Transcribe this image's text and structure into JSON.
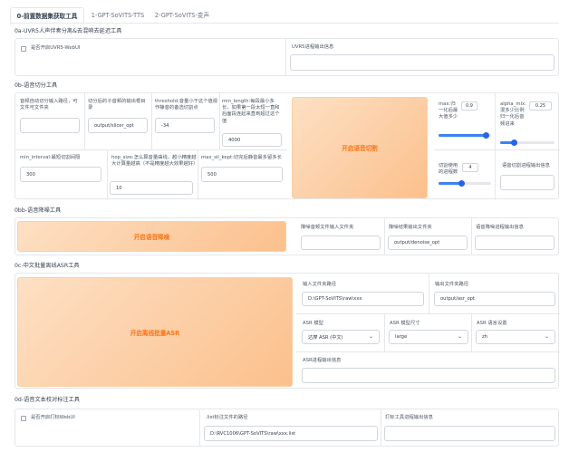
{
  "tabs": [
    {
      "label": "0-前置数据集获取工具",
      "active": true
    },
    {
      "label": "1-GPT-SoVITS-TTS",
      "active": false
    },
    {
      "label": "2-GPT-SoVITS-变声",
      "active": false
    }
  ],
  "uvr": {
    "title": "0a-UVR5人声伴奏分离&去混响去延迟工具",
    "checkbox_label": "是否开启UVR5-WebUI",
    "checked": false,
    "output_label": "UVR5进程输出信息",
    "output_value": ""
  },
  "slicer": {
    "title": "0b-语音切分工具",
    "input_path_label": "音频自动切分输入路径，可文件可文件夹",
    "input_path_value": "",
    "output_dir_label": "切分后的子音频的输出根目录",
    "output_dir_value": "output/slicer_opt",
    "threshold_label": "threshold:音量小于这个值视作静音的备选切割点",
    "threshold_value": "-34",
    "min_length_label": "min_length:每段最小多长，如果第一段太短一直和后面段连起来直到超过这个值",
    "min_length_value": "4000",
    "min_interval_label": "min_interval:最短切割间隔",
    "min_interval_value": "300",
    "hop_size_label": "hop_size:怎么算音量曲线，越小精度越大计算量越高（不是精度越大效果越好）",
    "hop_size_value": "10",
    "max_sil_kept_label": "max_sil_kept:切完后静音最多留多长",
    "max_sil_kept_value": "500",
    "button_label": "开启语音切割",
    "max_label": "max:归一化后最大值多少",
    "max_value": 0.9,
    "alpha_label": "alpha_mix:混多少比例归一化后音频进来",
    "alpha_value": 0.25,
    "n_process_label": "切割使用的进程数",
    "n_process_value": 4,
    "output_label": "语音切割进程输出信息",
    "output_value": ""
  },
  "denoise": {
    "title": "0bb-语音降噪工具",
    "button_label": "开启语音降噪",
    "input_label": "降噪音频文件输入文件夹",
    "input_value": "",
    "output_dir_label": "降噪结果输出文件夹",
    "output_dir_value": "output/denoise_opt",
    "info_label": "语音降噪进程输出信息",
    "info_value": ""
  },
  "asr": {
    "title": "0c-中文批量离线ASR工具",
    "button_label": "开启离线批量ASR",
    "input_label": "输入文件夹路径",
    "input_value": "D:\\GPT-SoVITS\\raw\\xxx",
    "output_label": "输出文件夹路径",
    "output_value": "output/asr_opt",
    "model_label": "ASR 模型",
    "model_value": "达摩 ASR (中文)",
    "size_label": "ASR 模型尺寸",
    "size_value": "large",
    "lang_label": "ASR 语言设置",
    "lang_value": "zh",
    "info_label": "ASR进程输出信息",
    "info_value": ""
  },
  "label_tool": {
    "title": "0d-语音文本校对标注工具",
    "checkbox_label": "是否开启打标WebUI",
    "checked": false,
    "list_path_label": ".list标注文件的路径",
    "list_path_value": "D:\\RVC1006\\GPT-SoVITS\\raw\\xxx.list",
    "info_label": "打标工具进程输出信息",
    "info_value": ""
  }
}
